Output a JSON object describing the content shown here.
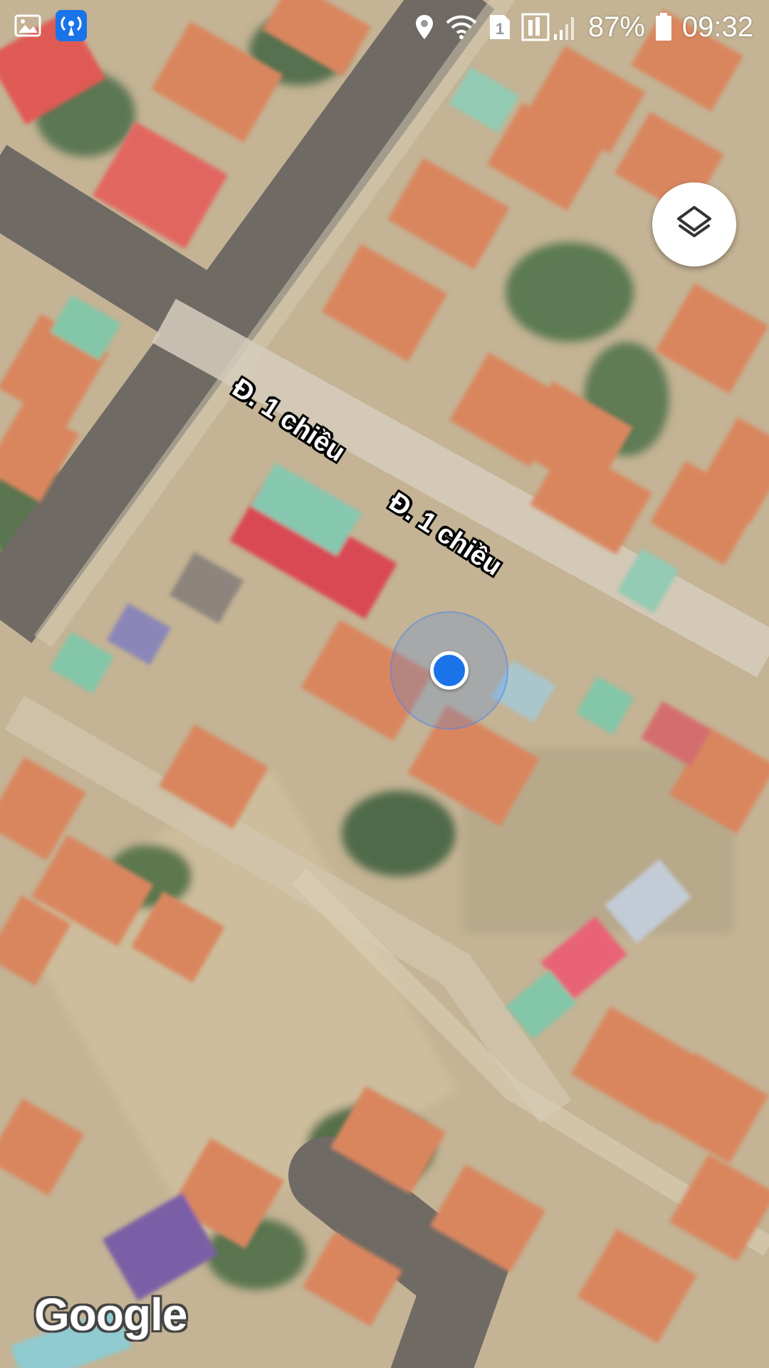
{
  "status_bar": {
    "battery_percent": "87%",
    "clock": "09:32",
    "sim_slot": "1",
    "icons": [
      "gallery-icon",
      "hotspot-icon",
      "location-icon",
      "wifi-icon",
      "sim-icon",
      "signal-icon",
      "battery-icon"
    ]
  },
  "map": {
    "view": "satellite",
    "street_labels": [
      "Đ. 1 chiều",
      "Đ. 1 chiều"
    ],
    "attribution": "Google"
  },
  "controls": {
    "layers_icon": "layers-icon"
  },
  "colors": {
    "location_blue": "#1a73e8",
    "roof_orange": "#d9865f",
    "road_gray": "#6f6a64"
  }
}
